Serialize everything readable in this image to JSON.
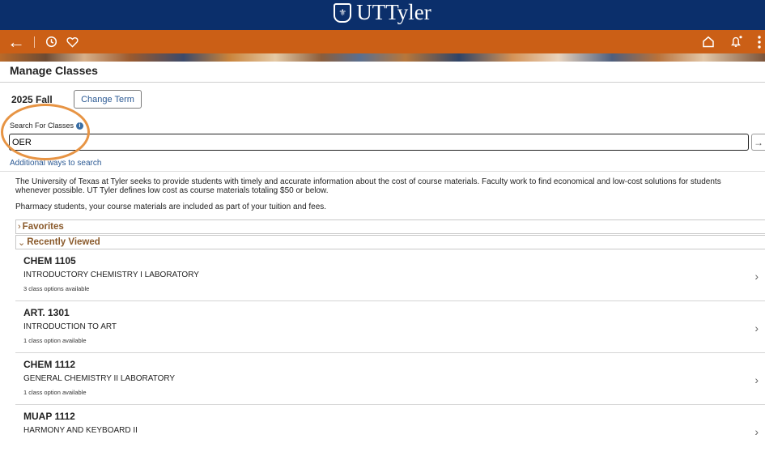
{
  "brand": {
    "logo_text": "UTTyler"
  },
  "nav": {
    "back_icon": "arrow-left-icon",
    "history_icon": "clock-icon",
    "favorites_icon": "heart-icon",
    "home_icon": "home-icon",
    "notifications_icon": "bell-icon",
    "menu_icon": "more-vertical-icon"
  },
  "page": {
    "title": "Manage Classes"
  },
  "term": {
    "label": "2025 Fall",
    "change_button": "Change Term"
  },
  "search": {
    "label": "Search For Classes",
    "value": "OER",
    "additional_link": "Additional ways to search"
  },
  "info": {
    "paragraph1": "The University of Texas at Tyler seeks to provide students with timely and accurate information about the cost of course materials. Faculty work to find economical and low-cost solutions for students whenever possible. UT Tyler defines low cost as course materials totaling $50 or below.",
    "paragraph2": "Pharmacy students, your course materials are included as part of your tuition and fees."
  },
  "sections": {
    "favorites": "Favorites",
    "recently_viewed": "Recently Viewed"
  },
  "courses": [
    {
      "code": "CHEM 1105",
      "name": "INTRODUCTORY CHEMISTRY I LABORATORY",
      "options": "3 class options available"
    },
    {
      "code": "ART. 1301",
      "name": "INTRODUCTION TO ART",
      "options": "1 class option available"
    },
    {
      "code": "CHEM 1112",
      "name": "GENERAL CHEMISTRY II LABORATORY",
      "options": "1 class option available"
    },
    {
      "code": "MUAP 1112",
      "name": "HARMONY AND KEYBOARD II",
      "options": ""
    }
  ],
  "colors": {
    "header_navy": "#0b2f6b",
    "nav_orange": "#cb5f16",
    "section_brown": "#8a5a2b",
    "link_blue": "#2c5a94",
    "highlight_circle": "#e79444"
  }
}
